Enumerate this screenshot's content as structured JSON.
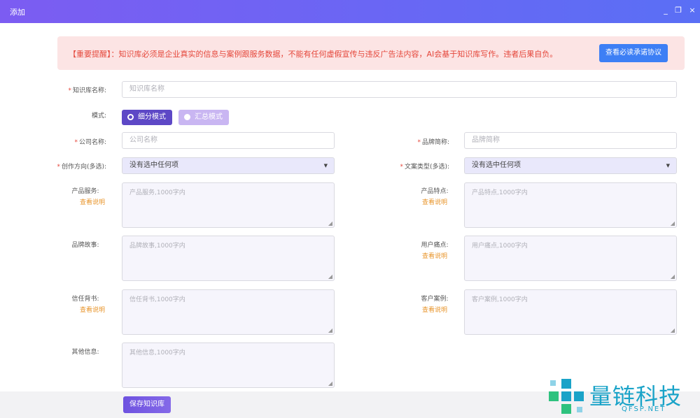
{
  "window": {
    "title": "添加",
    "controls": {
      "minimize": "_",
      "maximize": "❐",
      "close": "×"
    }
  },
  "notice": {
    "text": "【重要提醒】：知识库必须是企业真实的信息与案例跟服务数据，不能有任何虚假宣传与违反广告法内容，AI会基于知识库写作。违者后果自负。",
    "button": "查看必读承诺协议"
  },
  "form": {
    "kb_name": {
      "label": "知识库名称:",
      "placeholder": "知识库名称"
    },
    "mode": {
      "label": "模式:",
      "options": [
        "细分模式",
        "汇总模式"
      ],
      "selected": "细分模式"
    },
    "company": {
      "label": "公司名称:",
      "placeholder": "公司名称"
    },
    "brand": {
      "label": "品牌简称:",
      "placeholder": "品牌简称"
    },
    "direction": {
      "label": "创作方向(多选):",
      "value": "没有选中任何项"
    },
    "copy_type": {
      "label": "文案类型(多选):",
      "value": "没有选中任何项"
    },
    "product_service": {
      "label": "产品服务:",
      "link": "查看说明",
      "placeholder": "产品服务,1000字内"
    },
    "product_feature": {
      "label": "产品特点:",
      "link": "查看说明",
      "placeholder": "产品特点,1000字内"
    },
    "brand_story": {
      "label": "品牌故事:",
      "placeholder": "品牌故事,1000字内"
    },
    "pain_points": {
      "label": "用户痛点:",
      "link": "查看说明",
      "placeholder": "用户痛点,1000字内"
    },
    "trust": {
      "label": "信任背书:",
      "link": "查看说明",
      "placeholder": "信任背书,1000字内"
    },
    "cases": {
      "label": "客户案例:",
      "link": "查看说明",
      "placeholder": "客户案例,1000字内"
    },
    "other": {
      "label": "其他信息:",
      "placeholder": "其他信息,1000字内"
    }
  },
  "footer": {
    "save": "保存知识库"
  },
  "watermark": {
    "name": "量链科技",
    "domain": "QFSP.NET"
  },
  "colors": {
    "accent": "#5d48c6",
    "notice": "#e5473b",
    "link": "#e8952b",
    "button": "#3d7ff5"
  }
}
